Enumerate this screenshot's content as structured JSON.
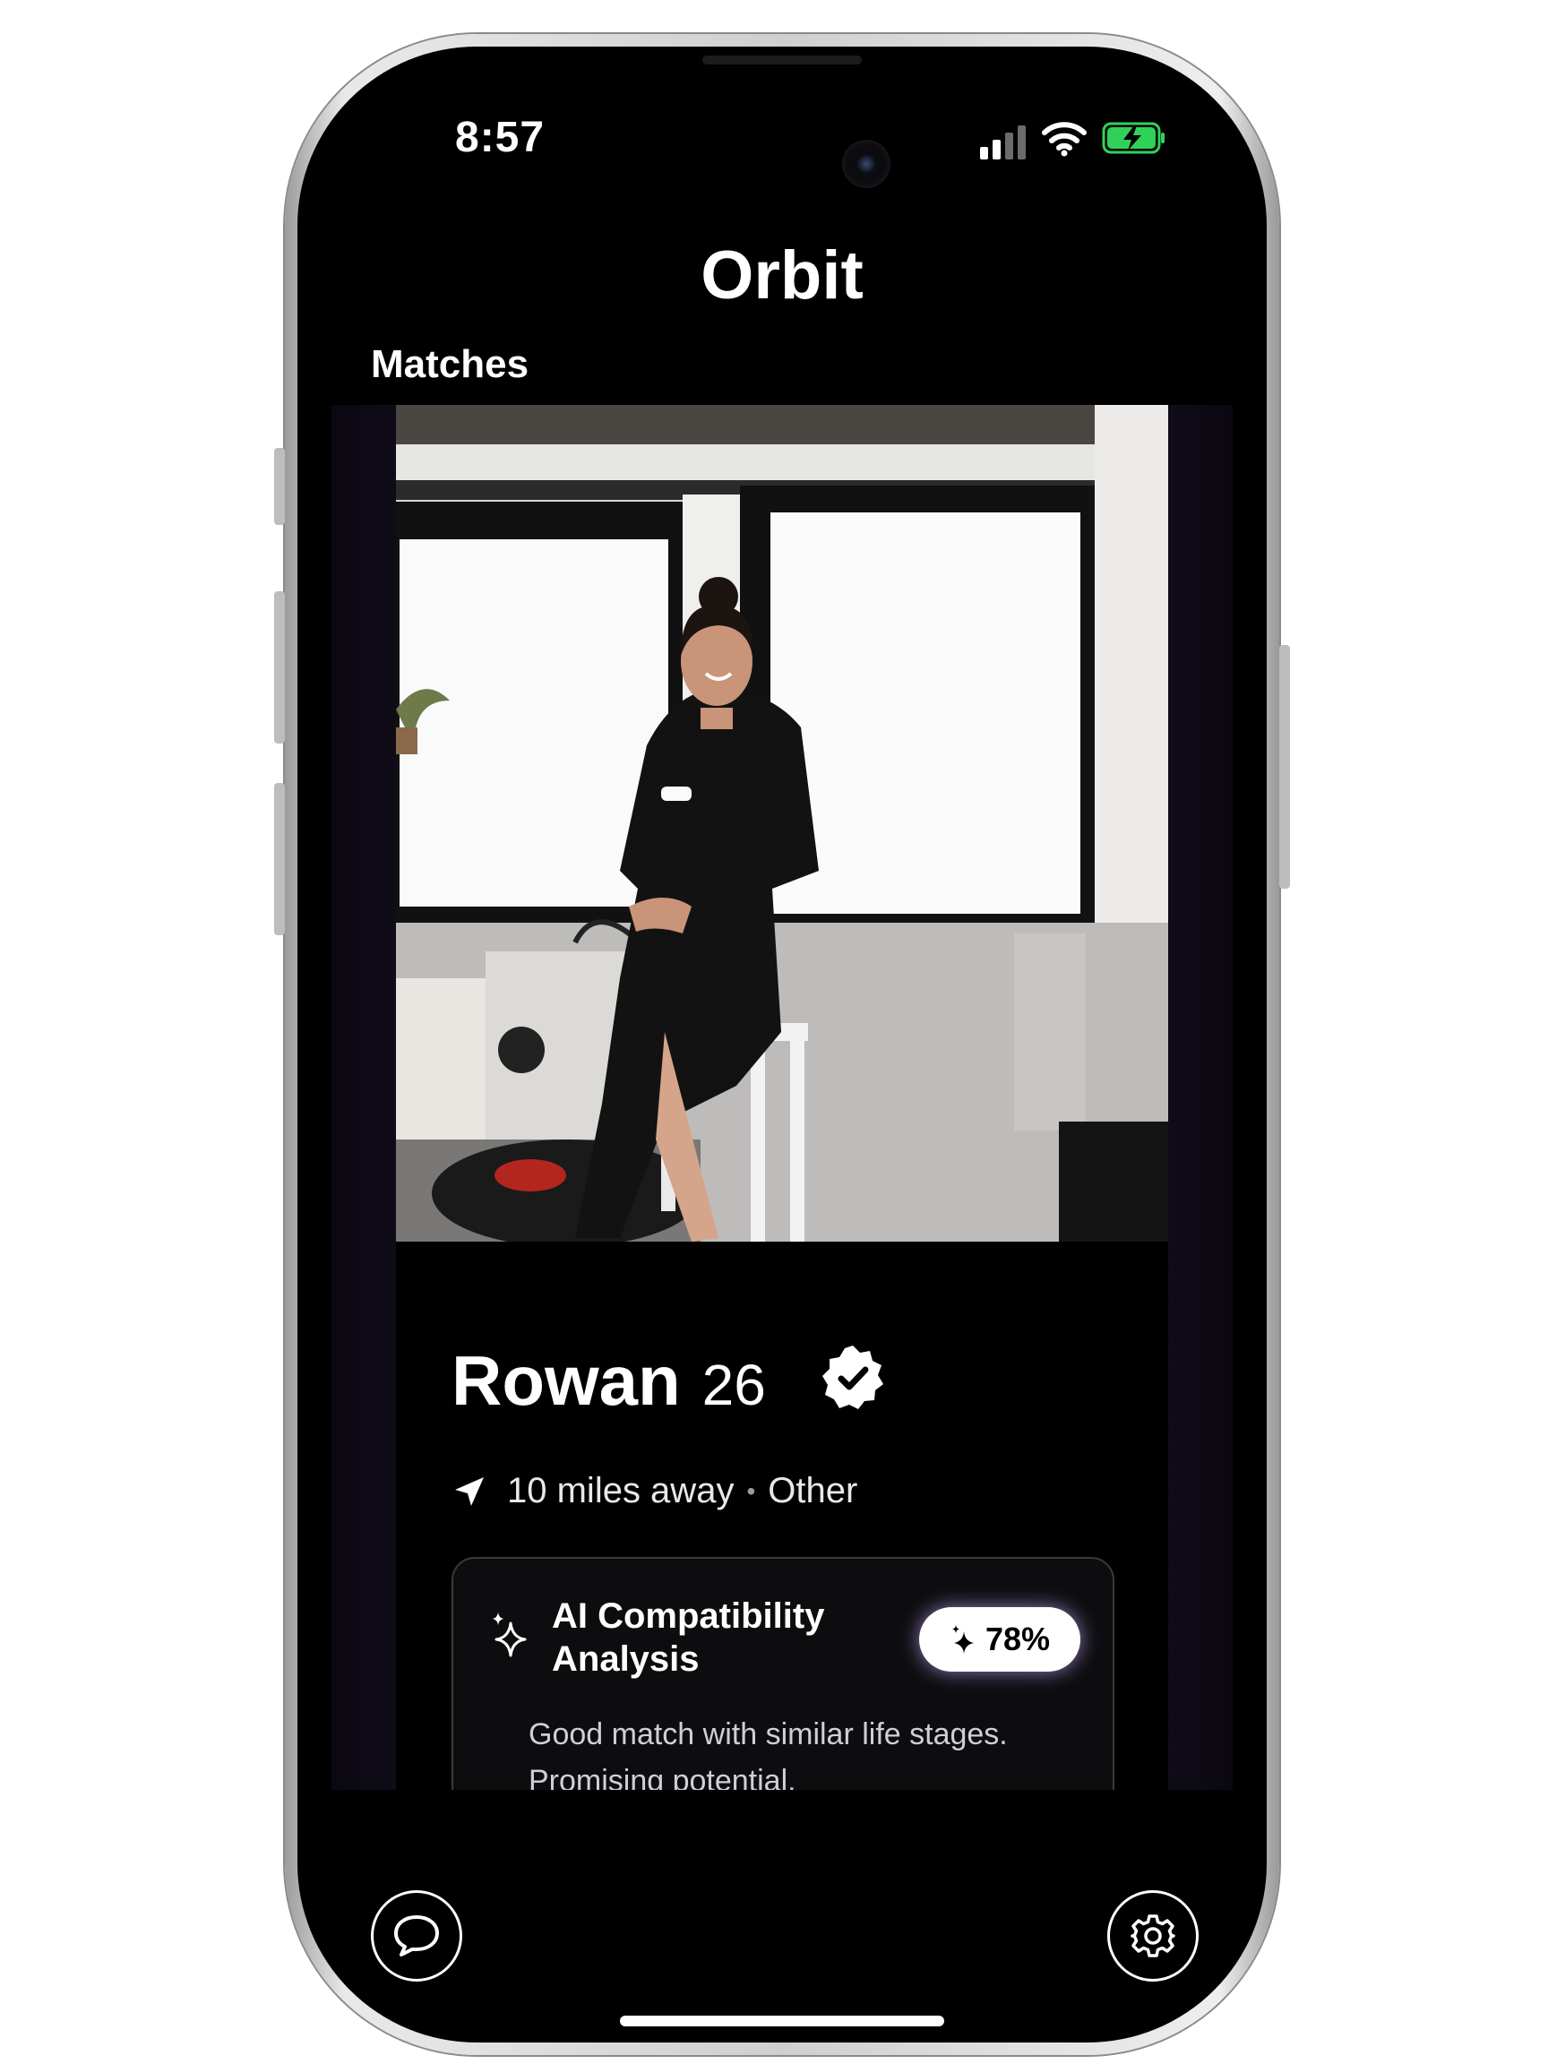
{
  "status_bar": {
    "time": "8:57",
    "battery_color": "#30d158"
  },
  "header": {
    "app_name": "Orbit",
    "section": "Matches"
  },
  "profile": {
    "name": "Rowan",
    "age": "26",
    "verified": true,
    "distance": "10 miles away",
    "gender": "Other"
  },
  "ai_analysis": {
    "title": "AI Compatibility Analysis",
    "score": "78%",
    "summary": "Good match with similar life stages. Promising potential."
  },
  "nav": {
    "left_icon": "chat-bubble-icon",
    "right_icon": "gear-icon"
  },
  "colors": {
    "background": "#000000",
    "card_glow": "#221a30",
    "accent": "#30d158"
  }
}
